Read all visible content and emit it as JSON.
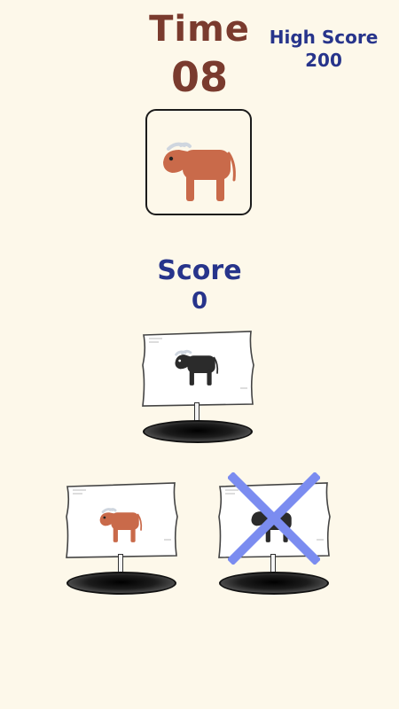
{
  "timer": {
    "label": "Time",
    "value": "08"
  },
  "high_score": {
    "label": "High Score",
    "value": "200"
  },
  "target": {
    "animal": "brown-ox-icon"
  },
  "score": {
    "label": "Score",
    "value": "0"
  },
  "holes": [
    {
      "animal": "black-bull-icon",
      "state": "showing"
    },
    {
      "animal": "brown-ox-icon",
      "state": "showing"
    },
    {
      "animal": "black-bull-icon",
      "state": "crossed-out"
    }
  ],
  "colors": {
    "background": "#fdf8ea",
    "time_text": "#7a3b2e",
    "score_text": "#27348b",
    "cross_mark": "#7b8cf0",
    "brown_ox": "#c96a4a",
    "black_bull": "#2b2b2b"
  }
}
